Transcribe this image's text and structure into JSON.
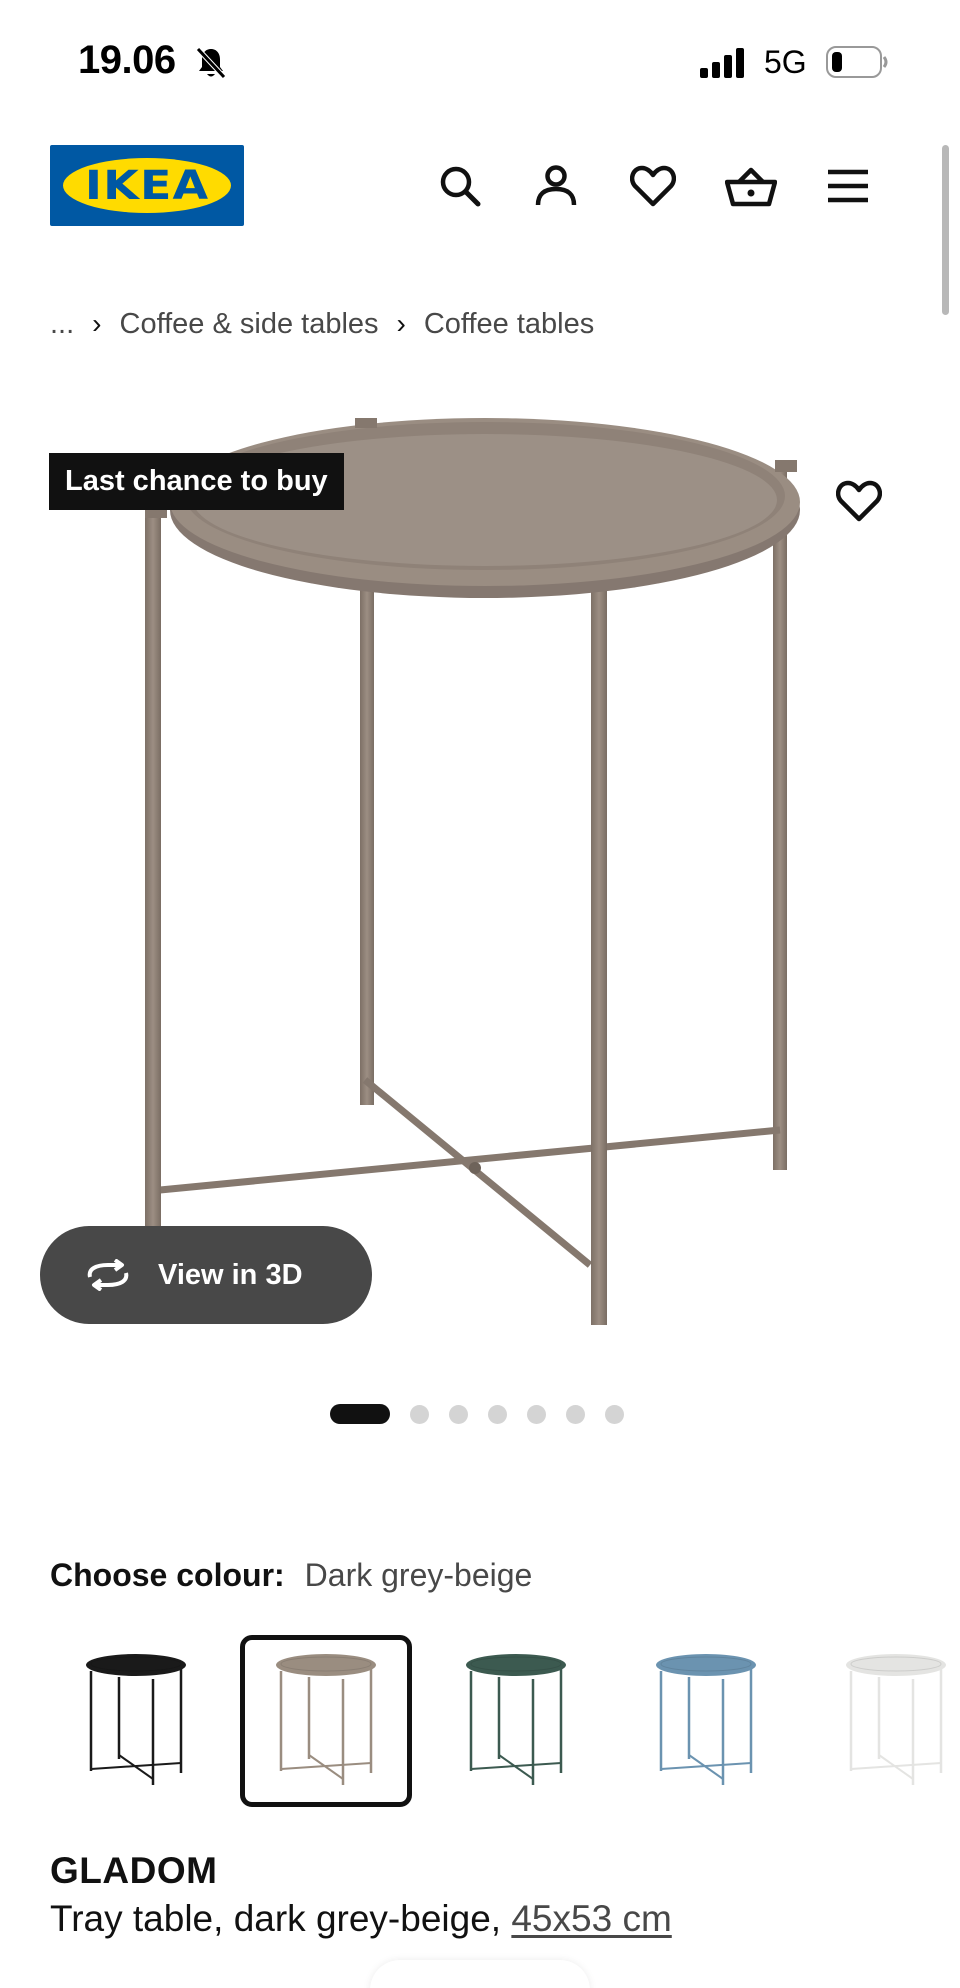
{
  "status_bar": {
    "time": "19.06",
    "network": "5G"
  },
  "header": {
    "logo_text": "IKEA",
    "icons": [
      "search-icon",
      "account-icon",
      "heart-icon",
      "basket-icon",
      "menu-icon"
    ]
  },
  "breadcrumb": {
    "ellipsis": "...",
    "items": [
      "Coffee & side tables",
      "Coffee tables"
    ]
  },
  "product_image": {
    "badge": "Last chance to buy",
    "view_3d_label": "View in 3D",
    "image_count": 7,
    "active_image_index": 0
  },
  "colour": {
    "label": "Choose colour:",
    "selected": "Dark grey-beige",
    "swatches": [
      {
        "color": "#1a1a1a"
      },
      {
        "color": "#9a8d80"
      },
      {
        "color": "#3c5a50"
      },
      {
        "color": "#6b93b0"
      },
      {
        "color": "#e4e4e2"
      }
    ],
    "selected_index": 1
  },
  "product": {
    "name": "GLADOM",
    "description": "Tray table, dark grey-beige,",
    "size": "45x53 cm"
  },
  "colors": {
    "brand_blue": "#0058a3",
    "brand_yellow": "#ffdb00",
    "table_color": "#8f8176"
  }
}
